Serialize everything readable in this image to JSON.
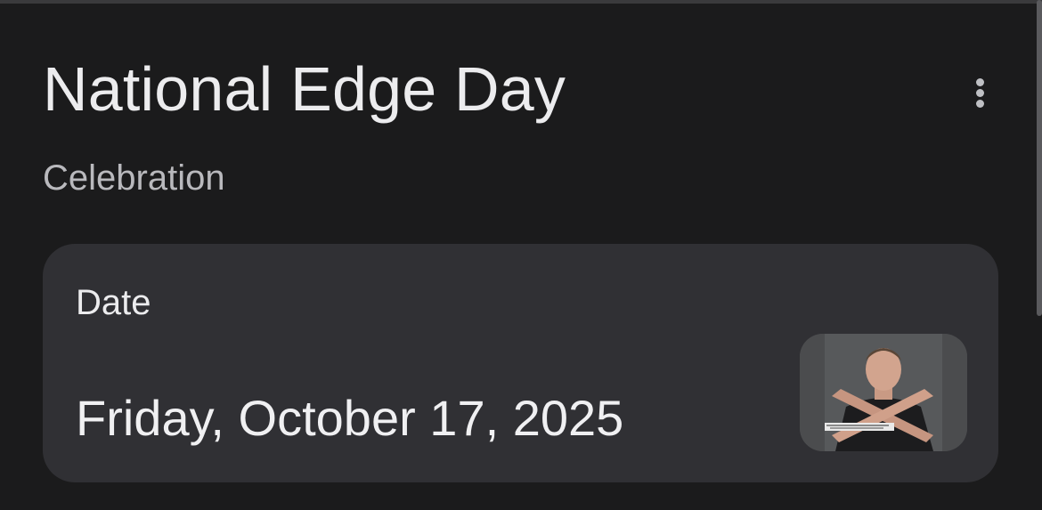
{
  "header": {
    "title": "National Edge Day",
    "category": "Celebration"
  },
  "more_menu": {
    "icon": "more-vert-icon"
  },
  "date_card": {
    "label": "Date",
    "value": "Friday, October 17, 2025",
    "thumbnail": {
      "icon": "event-thumbnail-image",
      "description": "man crossing arms in X shape"
    }
  },
  "colors": {
    "background": "#1b1b1c",
    "card": "#303034",
    "text_primary": "#ececee",
    "text_secondary": "#b9b9bd"
  }
}
